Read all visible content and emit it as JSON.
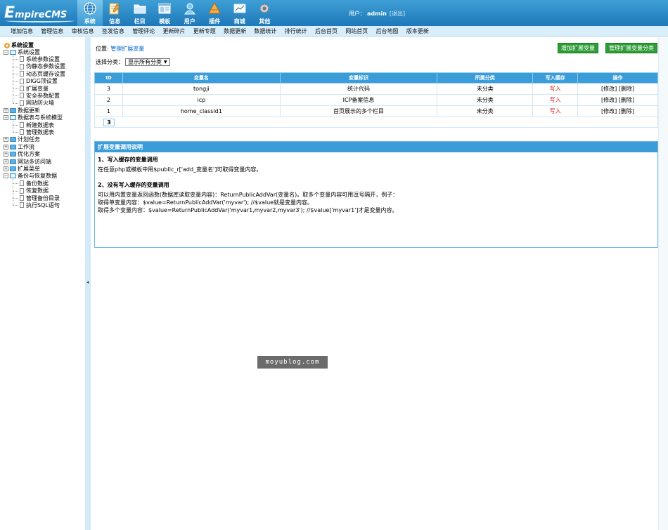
{
  "header": {
    "logo_e": "E",
    "logo_rest": "mpireCMS",
    "nav": [
      {
        "label": "系统",
        "icon": "globe-icon",
        "active": true
      },
      {
        "label": "信息",
        "icon": "edit-icon",
        "active": false
      },
      {
        "label": "栏目",
        "icon": "folder-icon",
        "active": false
      },
      {
        "label": "模板",
        "icon": "template-icon",
        "active": false
      },
      {
        "label": "用户",
        "icon": "user-icon",
        "active": false
      },
      {
        "label": "插件",
        "icon": "plugin-icon",
        "active": false
      },
      {
        "label": "商城",
        "icon": "shop-icon",
        "active": false
      },
      {
        "label": "其他",
        "icon": "gear-icon",
        "active": false
      }
    ],
    "user_label": "用户：",
    "username": "admin",
    "logout": "[退出]"
  },
  "submenu": [
    "增加信息",
    "管理信息",
    "审核信息",
    "签发信息",
    "管理评论",
    "更新碎片",
    "更新专题",
    "数据更新",
    "数据统计",
    "排行统计",
    "后台首页",
    "网站首页",
    "后台地图",
    "版本更新"
  ],
  "sidebar": {
    "root": "系统设置",
    "items": [
      {
        "label": "系统设置",
        "level": 0,
        "type": "folder-open",
        "toggle": "−"
      },
      {
        "label": "系统参数设置",
        "level": 1,
        "type": "page"
      },
      {
        "label": "伪静态参数设置",
        "level": 1,
        "type": "page"
      },
      {
        "label": "动态页缓存设置",
        "level": 1,
        "type": "page"
      },
      {
        "label": "DIGG顶设置",
        "level": 1,
        "type": "page"
      },
      {
        "label": "扩展变量",
        "level": 1,
        "type": "page"
      },
      {
        "label": "安全参数配置",
        "level": 1,
        "type": "page"
      },
      {
        "label": "网站防火墙",
        "level": 1,
        "type": "page"
      },
      {
        "label": "数据更新",
        "level": 0,
        "type": "folder",
        "toggle": "+"
      },
      {
        "label": "数据表与系统模型",
        "level": 0,
        "type": "folder-open",
        "toggle": "−"
      },
      {
        "label": "新建数据表",
        "level": 1,
        "type": "page"
      },
      {
        "label": "管理数据表",
        "level": 1,
        "type": "page"
      },
      {
        "label": "计划任务",
        "level": 0,
        "type": "folder",
        "toggle": "+"
      },
      {
        "label": "工作流",
        "level": 0,
        "type": "folder",
        "toggle": "+"
      },
      {
        "label": "优化方案",
        "level": 0,
        "type": "folder",
        "toggle": "+"
      },
      {
        "label": "网站多访问端",
        "level": 0,
        "type": "folder",
        "toggle": "+"
      },
      {
        "label": "扩展菜单",
        "level": 0,
        "type": "folder",
        "toggle": "+"
      },
      {
        "label": "备份与恢复数据",
        "level": 0,
        "type": "folder-open",
        "toggle": "−"
      },
      {
        "label": "备份数据",
        "level": 1,
        "type": "page"
      },
      {
        "label": "恢复数据",
        "level": 1,
        "type": "page"
      },
      {
        "label": "管理备份目录",
        "level": 1,
        "type": "page"
      },
      {
        "label": "执行SQL语句",
        "level": 1,
        "type": "page"
      }
    ],
    "collapse_arrow": "◂"
  },
  "main": {
    "crumb_prefix": "位置: ",
    "crumb_link": "管理扩展变量",
    "btn_add": "增加扩展变量",
    "btn_manage": "管理扩展变量分类",
    "filter_label": "选择分类：",
    "filter_value": "显示所有分类",
    "filter_arrow": "▼",
    "table": {
      "headers": [
        "ID",
        "变量名",
        "变量标识",
        "所属分类",
        "写入缓存",
        "操作"
      ],
      "rows": [
        {
          "id": "3",
          "name": "tongji",
          "title": "统计代码",
          "category": "未分类",
          "cache": "写入",
          "ops": "[修改] [删除]"
        },
        {
          "id": "2",
          "name": "icp",
          "title": "ICP备案信息",
          "category": "未分类",
          "cache": "写入",
          "ops": "[修改] [删除]"
        },
        {
          "id": "1",
          "name": "home_classid1",
          "title": "首页展示的多个栏目",
          "category": "未分类",
          "cache": "写入",
          "ops": "[修改] [删除]"
        }
      ],
      "pager": "3"
    },
    "help": {
      "title": "扩展变量调用说明",
      "h1": "1、写入缓存的变量调用",
      "p1": "在任意php或模板中用$public_r['add_变量名']可取得变量内容。",
      "h2": "2、没有写入缓存的变量调用",
      "p2": "可以用内置变量返回函数(数据库读取变量内容)：ReturnPublicAddVar(变量名)。取多个变量内容可用逗号隔开，例子：",
      "p3": "取得单变量内容：$value=ReturnPublicAddVar('myvar'); //$value就是变量内容。",
      "p4": "取得多个变量内容：$value=ReturnPublicAddVar('myvar1,myvar2,myvar3'); //$value['myvar1']才是变量内容。"
    }
  },
  "watermark": "moyublog.com"
}
